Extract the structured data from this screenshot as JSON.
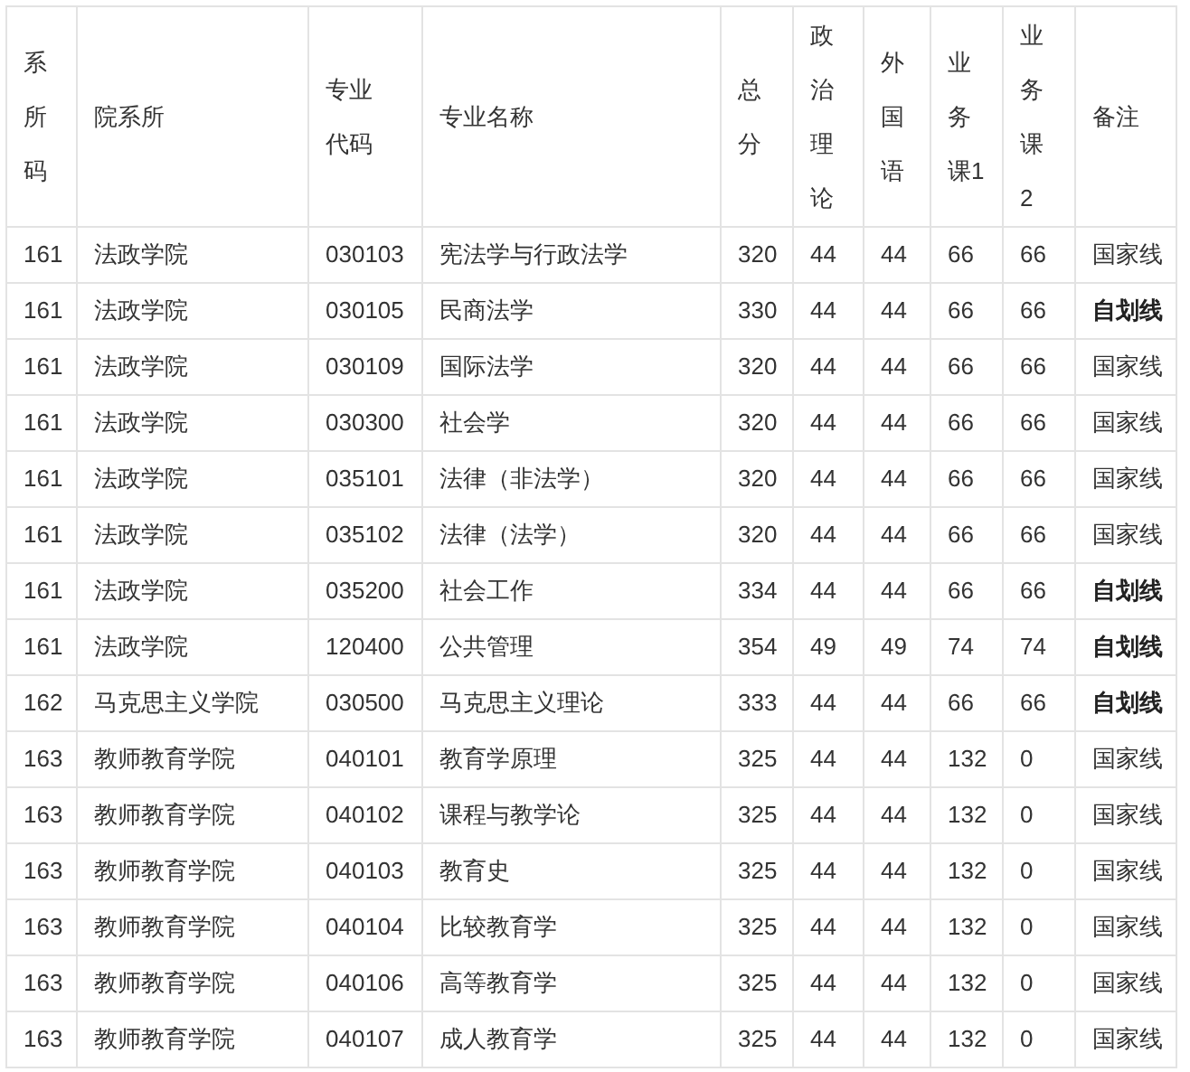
{
  "table": {
    "columns": [
      "系所码",
      "院系所",
      "专业代码",
      "专业名称",
      "总分",
      "政治理论",
      "外国语",
      "业务课1",
      "业务课2",
      "备注"
    ],
    "rows": [
      {
        "cells": [
          "161",
          "法政学院",
          "030103",
          "宪法学与行政法学",
          "320",
          "44",
          "44",
          "66",
          "66",
          "国家线"
        ],
        "note_bold": false
      },
      {
        "cells": [
          "161",
          "法政学院",
          "030105",
          "民商法学",
          "330",
          "44",
          "44",
          "66",
          "66",
          "自划线"
        ],
        "note_bold": true
      },
      {
        "cells": [
          "161",
          "法政学院",
          "030109",
          "国际法学",
          "320",
          "44",
          "44",
          "66",
          "66",
          "国家线"
        ],
        "note_bold": false
      },
      {
        "cells": [
          "161",
          "法政学院",
          "030300",
          "社会学",
          "320",
          "44",
          "44",
          "66",
          "66",
          "国家线"
        ],
        "note_bold": false
      },
      {
        "cells": [
          "161",
          "法政学院",
          "035101",
          "法律（非法学）",
          "320",
          "44",
          "44",
          "66",
          "66",
          "国家线"
        ],
        "note_bold": false
      },
      {
        "cells": [
          "161",
          "法政学院",
          "035102",
          "法律（法学）",
          "320",
          "44",
          "44",
          "66",
          "66",
          "国家线"
        ],
        "note_bold": false
      },
      {
        "cells": [
          "161",
          "法政学院",
          "035200",
          "社会工作",
          "334",
          "44",
          "44",
          "66",
          "66",
          "自划线"
        ],
        "note_bold": true
      },
      {
        "cells": [
          "161",
          "法政学院",
          "120400",
          "公共管理",
          "354",
          "49",
          "49",
          "74",
          "74",
          "自划线"
        ],
        "note_bold": true
      },
      {
        "cells": [
          "162",
          "马克思主义学院",
          "030500",
          "马克思主义理论",
          "333",
          "44",
          "44",
          "66",
          "66",
          "自划线"
        ],
        "note_bold": true
      },
      {
        "cells": [
          "163",
          "教师教育学院",
          "040101",
          "教育学原理",
          "325",
          "44",
          "44",
          "132",
          "0",
          "国家线"
        ],
        "note_bold": false
      },
      {
        "cells": [
          "163",
          "教师教育学院",
          "040102",
          "课程与教学论",
          "325",
          "44",
          "44",
          "132",
          "0",
          "国家线"
        ],
        "note_bold": false
      },
      {
        "cells": [
          "163",
          "教师教育学院",
          "040103",
          "教育史",
          "325",
          "44",
          "44",
          "132",
          "0",
          "国家线"
        ],
        "note_bold": false
      },
      {
        "cells": [
          "163",
          "教师教育学院",
          "040104",
          "比较教育学",
          "325",
          "44",
          "44",
          "132",
          "0",
          "国家线"
        ],
        "note_bold": false
      },
      {
        "cells": [
          "163",
          "教师教育学院",
          "040106",
          "高等教育学",
          "325",
          "44",
          "44",
          "132",
          "0",
          "国家线"
        ],
        "note_bold": false
      },
      {
        "cells": [
          "163",
          "教师教育学院",
          "040107",
          "成人教育学",
          "325",
          "44",
          "44",
          "132",
          "0",
          "国家线"
        ],
        "note_bold": false
      }
    ]
  }
}
